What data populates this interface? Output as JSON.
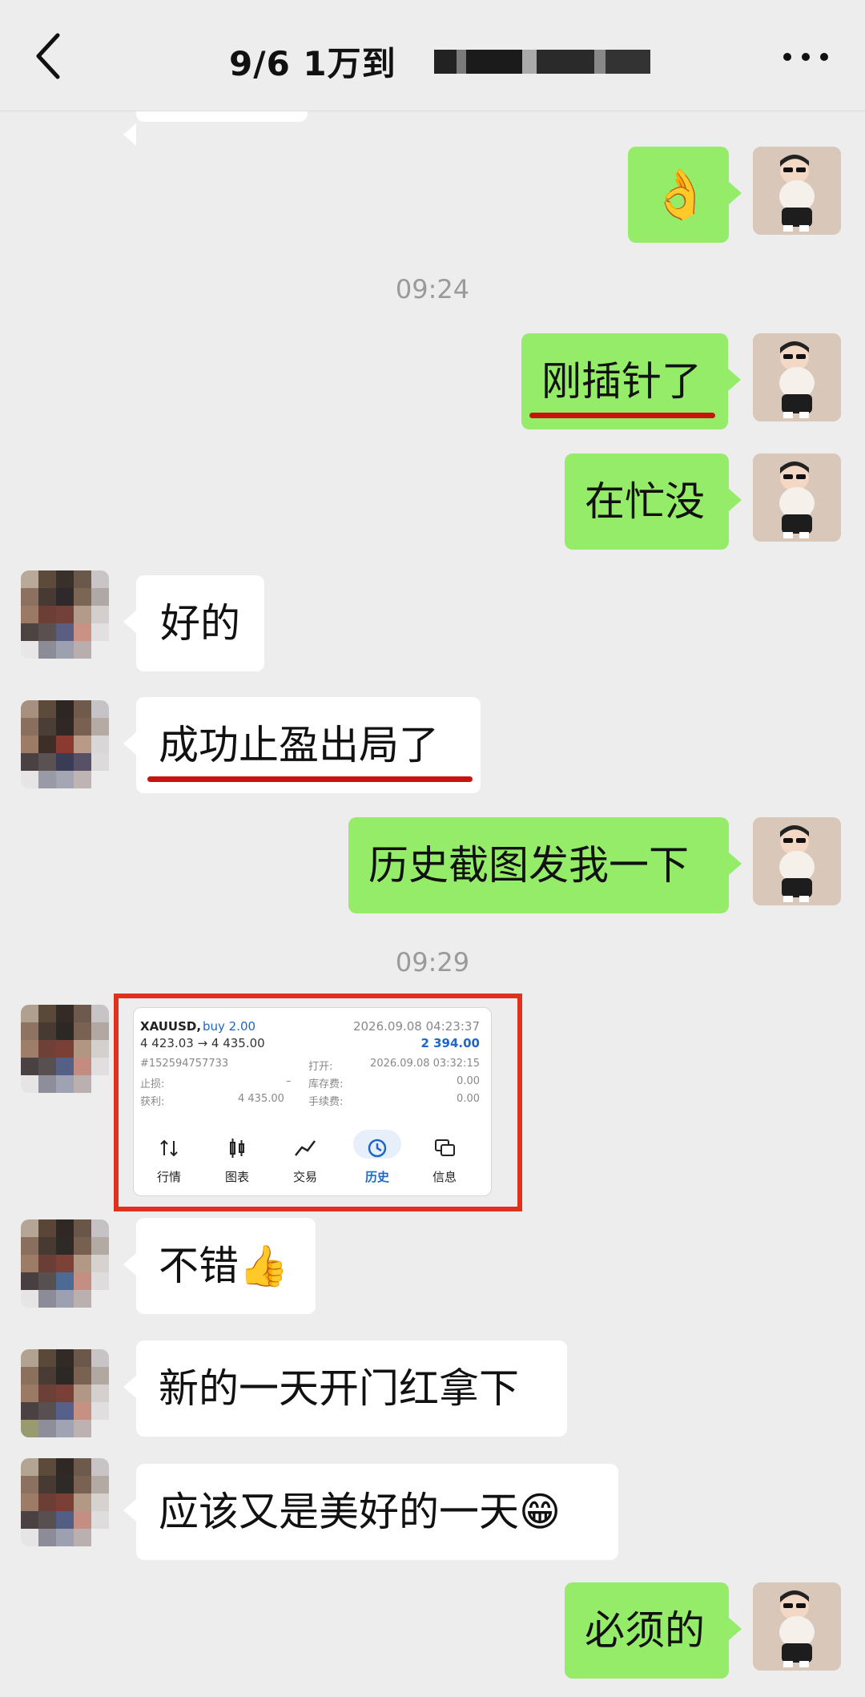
{
  "header": {
    "title": "9/6  1万到",
    "back_icon": "chevron-left-icon",
    "more_icon": "more-dots-icon"
  },
  "messages": {
    "m1": {
      "side": "right",
      "content": "👌"
    },
    "t1": "09:24",
    "m2": {
      "side": "right",
      "text": "刚插针了"
    },
    "m3": {
      "side": "right",
      "text": "在忙没"
    },
    "m4": {
      "side": "left",
      "text": "好的"
    },
    "m5": {
      "side": "left",
      "text": "成功止盈出局了"
    },
    "m6": {
      "side": "right",
      "text": "历史截图发我一下"
    },
    "t2": "09:29",
    "m8": {
      "side": "left",
      "text": "不错👍"
    },
    "m9": {
      "side": "left",
      "text": "新的一天开门红拿下"
    },
    "m10": {
      "side": "left",
      "text": "应该又是美好的一天😁"
    },
    "m11": {
      "side": "right",
      "text": "必须的"
    }
  },
  "screenshot": {
    "symbol": "XAUUSD,",
    "direction": "buy 2.00",
    "date": "2026.09.08 04:23:37",
    "prices": "4 423.03 → 4 435.00",
    "profit": "2 394.00",
    "ticket": "#152594757733",
    "open_label": "打开:",
    "open_time": "2026.09.08 03:32:15",
    "sl_label": "止损:",
    "sl_value": "–",
    "swap_label": "库存费:",
    "swap_value": "0.00",
    "tp_label": "获利:",
    "tp_value": "4 435.00",
    "fee_label": "手续费:",
    "fee_value": "0.00",
    "nav": [
      "行情",
      "图表",
      "交易",
      "历史",
      "信息"
    ],
    "active_nav": "历史"
  },
  "colors": {
    "bubble_me": "#95ec69",
    "bubble_them": "#ffffff",
    "underline": "#c8140a",
    "frame": "#e0301e",
    "accent_blue": "#1e67c8"
  }
}
